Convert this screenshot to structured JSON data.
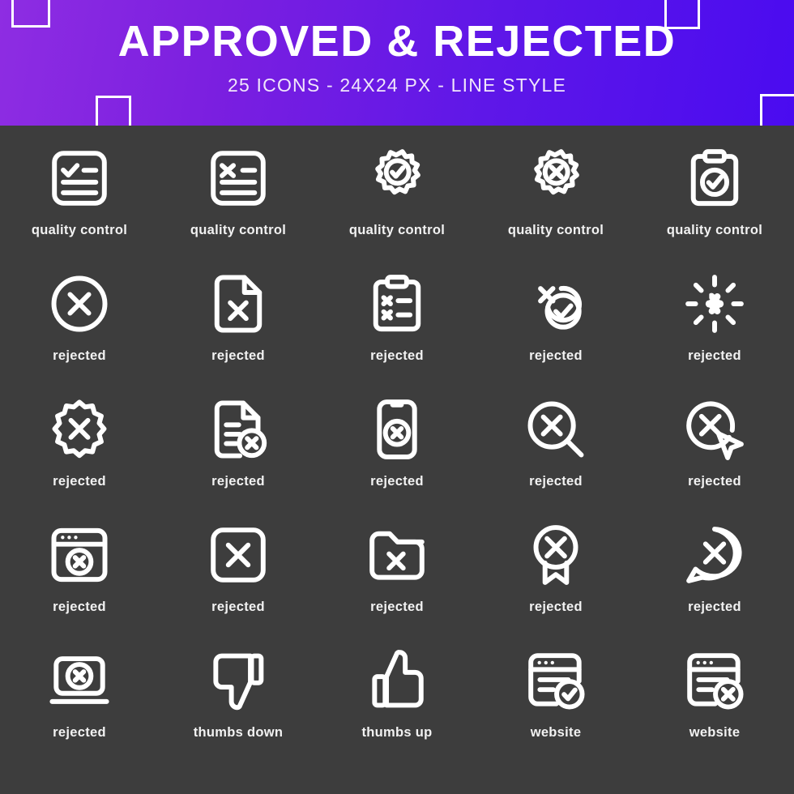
{
  "header": {
    "title": "APPROVED & REJECTED",
    "subtitle": "25 ICONS - 24X24 PX - LINE STYLE",
    "gradient_start": "#8e2de2",
    "gradient_end": "#4a0bf0",
    "text_color": "#ffffff"
  },
  "theme": {
    "background": "#3d3d3d",
    "icon_stroke": "#ffffff",
    "caption_color": "#f2f2f2"
  },
  "grid": {
    "columns": 5,
    "rows": 5,
    "total_icons": 25,
    "icons": [
      {
        "icon": "note-check-icon",
        "label": "quality control"
      },
      {
        "icon": "note-cross-icon",
        "label": "quality control"
      },
      {
        "icon": "gear-check-icon",
        "label": "quality control"
      },
      {
        "icon": "gear-cross-icon",
        "label": "quality control"
      },
      {
        "icon": "clipboard-check-icon",
        "label": "quality control"
      },
      {
        "icon": "circle-cross-icon",
        "label": "rejected"
      },
      {
        "icon": "document-cross-icon",
        "label": "rejected"
      },
      {
        "icon": "clipboard-cross-list-icon",
        "label": "rejected"
      },
      {
        "icon": "circles-cross-check-icon",
        "label": "rejected"
      },
      {
        "icon": "cross-burst-icon",
        "label": "rejected"
      },
      {
        "icon": "badge-starburst-cross-icon",
        "label": "rejected"
      },
      {
        "icon": "file-lines-cross-icon",
        "label": "rejected"
      },
      {
        "icon": "phone-cross-icon",
        "label": "rejected"
      },
      {
        "icon": "search-cross-icon",
        "label": "rejected"
      },
      {
        "icon": "circle-cross-cursor-icon",
        "label": "rejected"
      },
      {
        "icon": "browser-cross-icon",
        "label": "rejected"
      },
      {
        "icon": "square-cross-icon",
        "label": "rejected"
      },
      {
        "icon": "folder-cross-icon",
        "label": "rejected"
      },
      {
        "icon": "award-cross-icon",
        "label": "rejected"
      },
      {
        "icon": "chat-cross-icon",
        "label": "rejected"
      },
      {
        "icon": "laptop-cross-icon",
        "label": "rejected"
      },
      {
        "icon": "thumbs-down-icon",
        "label": "thumbs down"
      },
      {
        "icon": "thumbs-up-icon",
        "label": "thumbs up"
      },
      {
        "icon": "website-check-icon",
        "label": "website"
      },
      {
        "icon": "website-cross-icon",
        "label": "website"
      }
    ]
  }
}
